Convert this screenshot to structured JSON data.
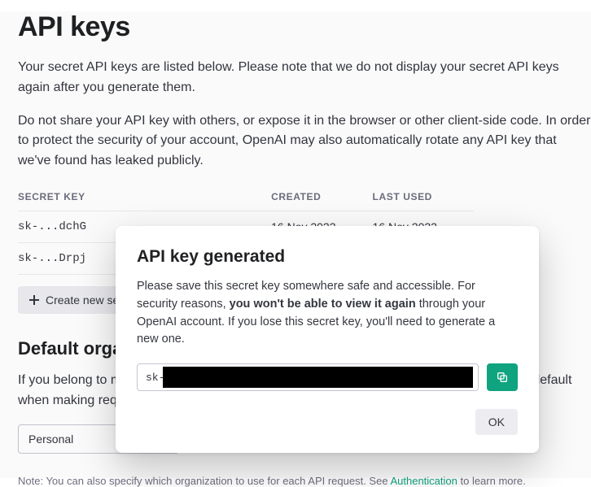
{
  "page": {
    "title": "API keys",
    "intro_1": "Your secret API keys are listed below. Please note that we do not display your secret API keys again after you generate them.",
    "intro_2": "Do not share your API key with others, or expose it in the browser or other client-side code. In order to protect the security of your account, OpenAI may also automatically rotate any API key that we've found has leaked publicly."
  },
  "table": {
    "headers": {
      "secret_key": "SECRET KEY",
      "created": "CREATED",
      "last_used": "LAST USED"
    },
    "rows": [
      {
        "key": "sk-...dchG",
        "created": "16 Nov 2022",
        "last_used": "16 Nov 2022"
      },
      {
        "key": "sk-...Drpj",
        "created": "",
        "last_used": ""
      }
    ]
  },
  "create_button": "Create new secret key",
  "default_org": {
    "heading": "Default organization",
    "text": "If you belong to multiple organizations, this setting controls which organization is used by default when making requests with the API keys above.",
    "selected": "Personal"
  },
  "note": {
    "prefix": "Note: You can also specify which organization to use for each API request. See ",
    "link": "Authentication",
    "suffix": " to learn more."
  },
  "modal": {
    "title": "API key generated",
    "text_1": "Please save this secret key somewhere safe and accessible. For security reasons, ",
    "text_bold": "you won't be able to view it again",
    "text_2": " through your OpenAI account. If you lose this secret key, you'll need to generate a new one.",
    "key_prefix": "sk-",
    "ok": "OK"
  }
}
